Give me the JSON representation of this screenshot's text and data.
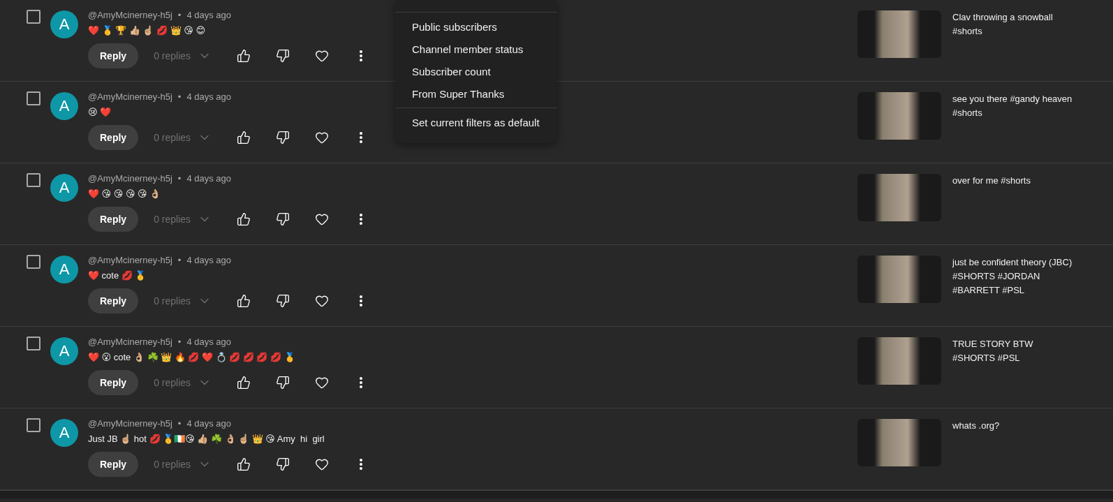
{
  "comments": [
    {
      "checked": false,
      "avatar_letter": "A",
      "author": "@AmyMcinerney-h5j",
      "separator": "•",
      "time": "4 days ago",
      "text": "❤️ 🥇 🏆 👍🏼 ☝🏼 💋 👑 😘 😊",
      "reply_label": "Reply",
      "replies": "0 replies",
      "video_title": "Clav throwing a snowball #shorts"
    },
    {
      "checked": false,
      "avatar_letter": "A",
      "author": "@AmyMcinerney-h5j",
      "separator": "•",
      "time": "4 days ago",
      "text": "😢 ❤️",
      "reply_label": "Reply",
      "replies": "0 replies",
      "video_title": "see you there #gandy heaven #shorts"
    },
    {
      "checked": false,
      "avatar_letter": "A",
      "author": "@AmyMcinerney-h5j",
      "separator": "•",
      "time": "4 days ago",
      "text": "❤️ 😘 😘 😘 😘 👌🏼",
      "reply_label": "Reply",
      "replies": "0 replies",
      "video_title": "over for me #shorts"
    },
    {
      "checked": false,
      "avatar_letter": "A",
      "author": "@AmyMcinerney-h5j",
      "separator": "•",
      "time": "4 days ago",
      "text": "❤️ cote 💋 🥇",
      "reply_label": "Reply",
      "replies": "0 replies",
      "video_title": "just be confident theory (JBC) #SHORTS #JORDAN #BARRETT #PSL"
    },
    {
      "checked": false,
      "avatar_letter": "A",
      "author": "@AmyMcinerney-h5j",
      "separator": "•",
      "time": "4 days ago",
      "text": "❤️ 😮 cote 👌🏼 ☘️ 👑 🔥 💋 ❤️ 💍 💋 💋 💋 💋 🥇",
      "reply_label": "Reply",
      "replies": "0 replies",
      "video_title": "TRUE STORY BTW #SHORTS #PSL"
    },
    {
      "checked": false,
      "avatar_letter": "A",
      "author": "@AmyMcinerney-h5j",
      "separator": "•",
      "time": "4 days ago",
      "text": "Just JB ☝🏼 hot 💋 🥇🇮🇪😘 👍🏼 ☘️ 👌🏼 ☝🏼 👑 😘 Amy  hi  girl",
      "reply_label": "Reply",
      "replies": "0 replies",
      "video_title": "whats .org?"
    }
  ],
  "filter_menu": {
    "sections": [
      {
        "items": [
          "Public subscribers",
          "Channel member status",
          "Subscriber count",
          "From Super Thanks"
        ]
      },
      {
        "items": [
          "Set current filters as default"
        ]
      }
    ]
  }
}
